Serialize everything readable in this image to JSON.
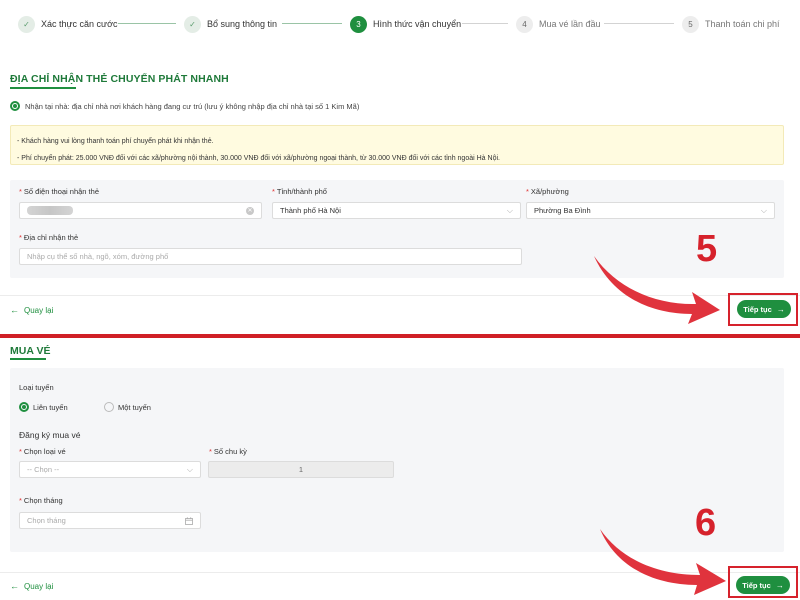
{
  "stepper": {
    "steps": [
      {
        "num": "✓",
        "label": "Xác thực căn cước",
        "state": "done"
      },
      {
        "num": "✓",
        "label": "Bổ sung thông tin",
        "state": "done"
      },
      {
        "num": "3",
        "label": "Hình thức vận chuyển",
        "state": "current"
      },
      {
        "num": "4",
        "label": "Mua vé lần đầu",
        "state": "todo"
      },
      {
        "num": "5",
        "label": "Thanh toán chi phí",
        "state": "todo"
      }
    ]
  },
  "delivery": {
    "title": "ĐỊA CHỈ NHẬN THẺ CHUYỂN PHÁT NHANH",
    "option_label": "Nhận tại nhà: địa chỉ nhà nơi khách hàng đang cư trú (lưu ý không nhập địa chỉ nhà tại số 1 Kim Mã)",
    "notice_lines": [
      "- Khách hàng vui lòng thanh toán phí chuyển phát khi nhận thẻ.",
      "- Phí chuyển phát: 25.000 VNĐ đối với các xã/phường nội thành, 30.000 VNĐ đối với xã/phường ngoại thành, từ 30.000 VNĐ đối với các tỉnh ngoài Hà Nội."
    ],
    "phone_label": "Số điện thoại nhận thẻ",
    "city_label": "Tỉnh/thành phố",
    "city_value": "Thành phố Hà Nội",
    "ward_label": "Xã/phường",
    "ward_value": "Phường Ba Đình",
    "address_label": "Địa chỉ nhận thẻ",
    "address_placeholder": "Nhập cụ thể số nhà, ngõ, xóm, đường phố"
  },
  "nav1": {
    "back": "Quay lại",
    "next": "Tiếp tục"
  },
  "annotation1": "5",
  "ticket": {
    "title": "MUA VÉ",
    "route_type_label": "Loại tuyến",
    "route_options": [
      "Liên tuyến",
      "Một tuyến"
    ],
    "route_selected": "Liên tuyến",
    "register_heading": "Đăng ký mua vé",
    "ticket_type_label": "Chọn loại vé",
    "ticket_type_value": "-- Chọn --",
    "cycles_label": "Số chu kỳ",
    "cycles_value": "1",
    "month_label": "Chọn tháng",
    "month_placeholder": "Chọn tháng"
  },
  "nav2": {
    "back": "Quay lại",
    "next": "Tiếp tục"
  },
  "annotation2": "6",
  "colors": {
    "brand_green": "#1f8f3f",
    "annotation_red": "#d6222c",
    "notice_bg": "#fffbe0"
  }
}
